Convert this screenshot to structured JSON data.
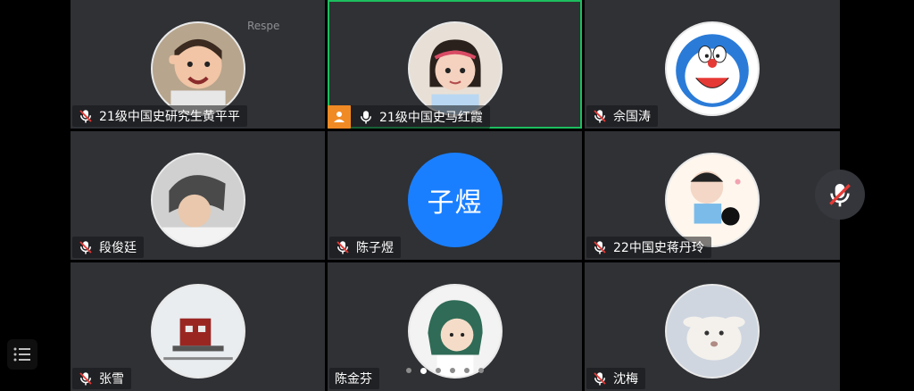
{
  "participants": [
    {
      "name": "21级中国史研究生黄平平",
      "mic": "muted",
      "avatar": "boy-saluting-photo"
    },
    {
      "name": "21级中国史马红霞",
      "mic": "on",
      "avatar": "girl-photo",
      "host": true,
      "active": true
    },
    {
      "name": "佘国涛",
      "mic": "muted",
      "avatar": "doraemon"
    },
    {
      "name": "段俊廷",
      "mic": "muted",
      "avatar": "person-photo"
    },
    {
      "name": "陈子煜",
      "mic": "on",
      "avatar": "text",
      "avatar_text": "子煜"
    },
    {
      "name": "22中国史蒋丹玲",
      "mic": "muted",
      "avatar": "cartoon-kid"
    },
    {
      "name": "张雪",
      "mic": "muted",
      "avatar": "train-photo"
    },
    {
      "name": "陈金芬",
      "mic": "none",
      "avatar": "anime-girl"
    },
    {
      "name": "沈梅",
      "mic": "muted",
      "avatar": "animal-photo"
    }
  ],
  "watermark_text": "Respe",
  "controls": {
    "mic_button": "muted-mic-icon",
    "menu_button": "list-menu-icon"
  },
  "pagination": {
    "pages": 6,
    "current": 2
  }
}
